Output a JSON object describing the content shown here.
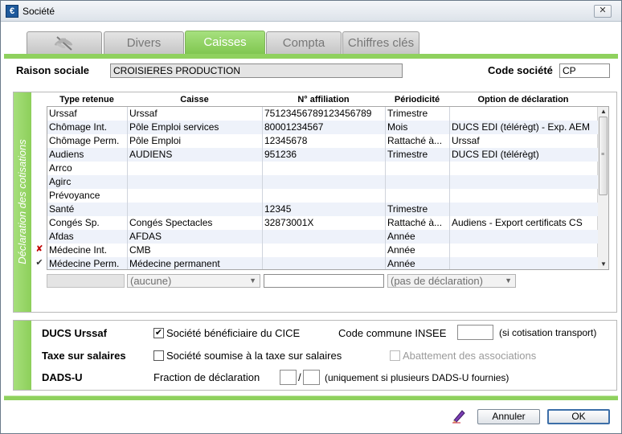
{
  "window": {
    "title": "Société",
    "app_icon": "€",
    "close_glyph": "✕"
  },
  "tabs": [
    {
      "label": "",
      "icon": "dragonfly-icon",
      "active": false
    },
    {
      "label": "Divers",
      "active": false
    },
    {
      "label": "Caisses",
      "active": true
    },
    {
      "label": "Compta",
      "active": false
    },
    {
      "label": "Chiffres clés",
      "active": false
    }
  ],
  "header": {
    "raison_label": "Raison sociale",
    "raison_value": "CROISIERES PRODUCTION",
    "code_label": "Code société",
    "code_value": "CP"
  },
  "cotisations": {
    "side_label": "Déclaration des cotisations",
    "columns": [
      "Type retenue",
      "Caisse",
      "N° affiliation",
      "Périodicité",
      "Option de déclaration"
    ],
    "rows": [
      {
        "marker": "",
        "type": "Urssaf",
        "caisse": "Urssaf",
        "affiliation": "75123456789123456789",
        "periodicite": "Trimestre",
        "option": ""
      },
      {
        "marker": "",
        "type": "Chômage Int.",
        "caisse": "Pôle Emploi services",
        "affiliation": "80001234567",
        "periodicite": "Mois",
        "option": "DUCS EDI (télérègt) - Exp. AEM"
      },
      {
        "marker": "",
        "type": "Chômage Perm.",
        "caisse": "Pôle Emploi",
        "affiliation": "12345678",
        "periodicite": "Rattaché à...",
        "option": "Urssaf"
      },
      {
        "marker": "",
        "type": "Audiens",
        "caisse": "AUDIENS",
        "affiliation": "951236",
        "periodicite": "Trimestre",
        "option": "DUCS EDI (télérègt)"
      },
      {
        "marker": "",
        "type": "Arrco",
        "caisse": "",
        "affiliation": "",
        "periodicite": "",
        "option": ""
      },
      {
        "marker": "",
        "type": "Agirc",
        "caisse": "",
        "affiliation": "",
        "periodicite": "",
        "option": ""
      },
      {
        "marker": "",
        "type": "Prévoyance",
        "caisse": "",
        "affiliation": "",
        "periodicite": "",
        "option": ""
      },
      {
        "marker": "",
        "type": "Santé",
        "caisse": "",
        "affiliation": "12345",
        "periodicite": "Trimestre",
        "option": ""
      },
      {
        "marker": "",
        "type": "Congés Sp.",
        "caisse": "Congés Spectacles",
        "affiliation": "32873001X",
        "periodicite": "Rattaché à...",
        "option": "Audiens - Export certificats CS"
      },
      {
        "marker": "",
        "type": "Afdas",
        "caisse": "AFDAS",
        "affiliation": "",
        "periodicite": "Année",
        "option": ""
      },
      {
        "marker": "✘",
        "type": "Médecine Int.",
        "caisse": "CMB",
        "affiliation": "",
        "periodicite": "Année",
        "option": ""
      },
      {
        "marker": "✔",
        "type": "Médecine Perm.",
        "caisse": "Médecine permanent",
        "affiliation": "",
        "periodicite": "Année",
        "option": ""
      }
    ],
    "editor": {
      "caisse_combo": "(aucune)",
      "affiliation_value": "",
      "option_combo": "(pas de déclaration)"
    }
  },
  "options": {
    "ducs_label": "DUCS Urssaf",
    "cice_label": "Société bénéficiaire du CICE",
    "cice_checked": true,
    "insee_label": "Code commune INSEE",
    "insee_note": "(si cotisation transport)",
    "taxe_label": "Taxe sur salaires",
    "taxe_cb_label": "Société soumise à la taxe sur salaires",
    "taxe_checked": false,
    "abattement_label": "Abattement des associations",
    "dadsu_label": "DADS-U",
    "fraction_label": "Fraction de déclaration",
    "fraction_sep": "/",
    "fraction_note": "(uniquement si plusieurs DADS-U fournies)"
  },
  "footer": {
    "annuler_label": "Annuler",
    "ok_label": "OK",
    "pen_icon": "pen-icon"
  },
  "colors": {
    "accent_green": "#8fd15e",
    "error_marker": "#c00000",
    "check_marker": "#333333"
  }
}
